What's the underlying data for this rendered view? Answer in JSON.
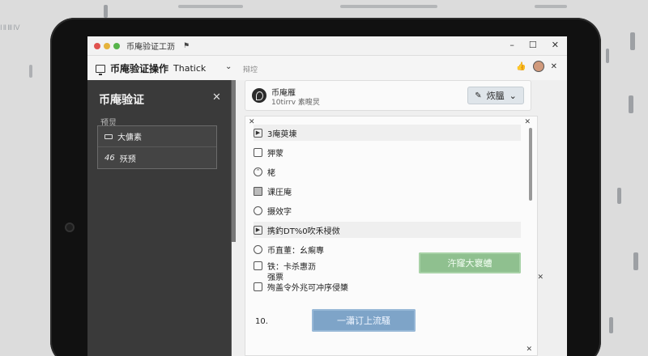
{
  "window": {
    "title": "币庵验证工沥",
    "flag": "⚑"
  },
  "win_controls": [
    "–",
    "☐",
    "✕"
  ],
  "header": {
    "app_title": "币庵验证操作",
    "app_sub": "Thatick",
    "breadcrumb": "辩埪"
  },
  "sidebar": {
    "title": "币庵验证",
    "section": "预炅",
    "items": [
      {
        "label": "大傭素"
      },
      {
        "num": "46",
        "label": "殀预"
      }
    ]
  },
  "profile": {
    "name": "币庵雁",
    "sub": "10tirrv 素瞍炅",
    "button_label": "烣膃"
  },
  "options": [
    {
      "label": "3庵萸埬"
    },
    {
      "label": "狎蒙"
    },
    {
      "label": "栳"
    },
    {
      "label": "课圧庵"
    },
    {
      "label": "摄效字"
    },
    {
      "label": "携釣DT%0吹禾梫傚"
    },
    {
      "label": "币直董：幺痸專"
    }
  ],
  "multi": {
    "line1": "铁：卡杀惠沥",
    "line2": "强票",
    "line3": "殉盖令外兆可冲序侵橥"
  },
  "green_button": "汻窿大褱螬",
  "panel_number": "10.",
  "blue_button": "一瀟订上流騷"
}
